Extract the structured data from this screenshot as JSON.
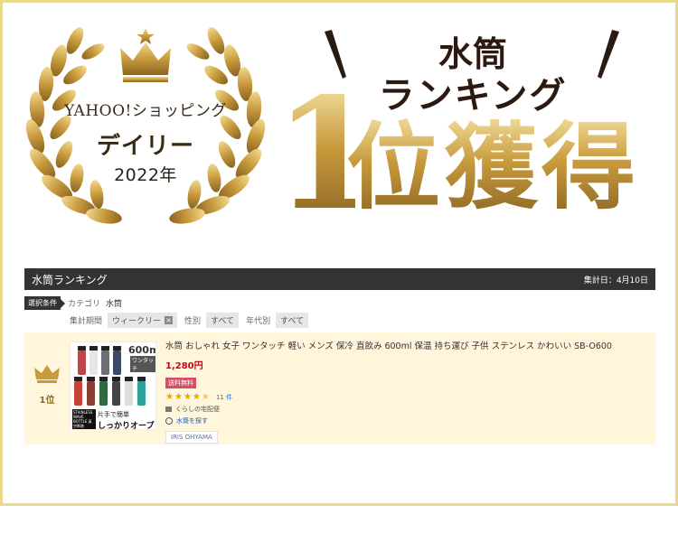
{
  "banner": {
    "store": "YAHOO!ショッピング",
    "period": "デイリー",
    "year": "2022年",
    "category": "水筒",
    "ranking_word": "ランキング",
    "rank_big": "1",
    "rank_suffix": "位獲得"
  },
  "colors": {
    "gold": "#c9a04c",
    "laurel_gold": "#c89a3c",
    "frame": "#e8d98a",
    "header_bg": "#333333",
    "item_bg": "#fff6dc",
    "price": "#d0021b",
    "ship_badge": "#d94d62"
  },
  "panel": {
    "title": "水筒ランキング",
    "date": "集計日：4月10日",
    "condition_tag": "選択条件",
    "category_key": "カテゴリ",
    "category_value": "水筒",
    "filters": {
      "period_label": "集計期間",
      "period_value": "ウィークリー",
      "gender_label": "性別",
      "gender_value": "すべて",
      "age_label": "年代別",
      "age_value": "すべて"
    }
  },
  "item": {
    "rank": "1位",
    "title": "水筒 おしゃれ 女子 ワンタッチ 軽い メンズ 保冷 直飲み 600ml 保温 持ち運び 子供 ステンレス かわいい SB-O600",
    "price": "1,280円",
    "shipping": "送料無料",
    "rating": 4.5,
    "review_count": "11 件",
    "store": "くらしの宅配便",
    "search_link": "水筒を探す",
    "brand": "IRIS OHYAMA",
    "thumb": {
      "capacity": "600ml",
      "sub": "ワンタッチ",
      "brand_text": "STAINLESS WAVE BOTTLE 真空断熱",
      "copy1": "片手で簡単",
      "copy2": "しっかりオープン",
      "bottle_colors": [
        "#b8494b",
        "#e6e6e6",
        "#6e6e76",
        "#3a4a6a",
        "#c64436",
        "#8a4030",
        "#2f6b3e",
        "#444",
        "#dcdcdc",
        "#2aa39a"
      ]
    }
  }
}
